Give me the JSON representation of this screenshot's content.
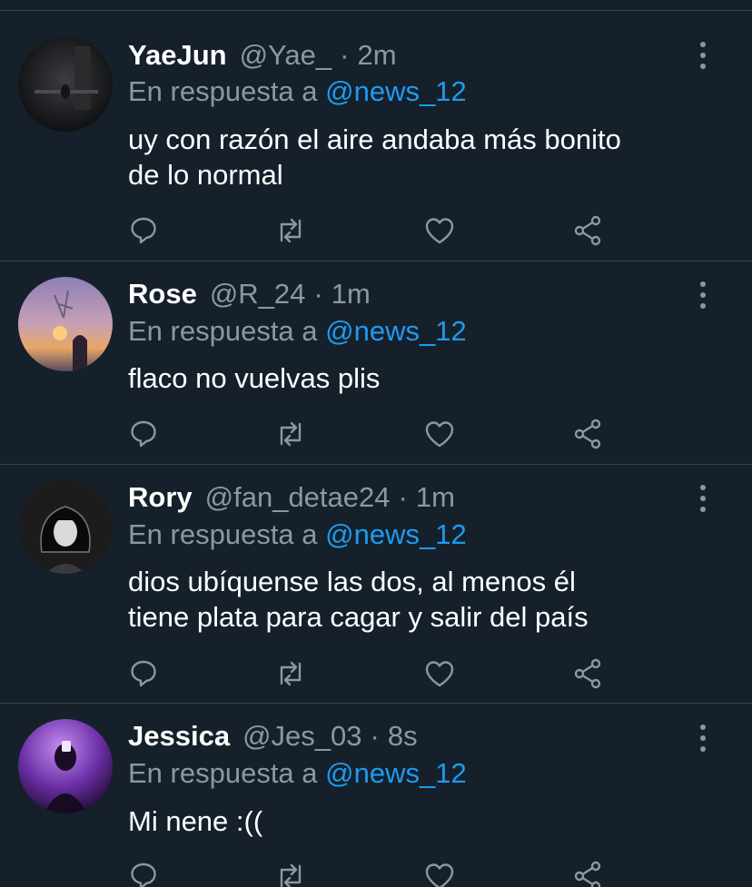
{
  "colors": {
    "background": "#15202b",
    "divider": "#38444d",
    "muted": "#8899a6",
    "mention": "#1d9bf0",
    "text": "#ffffff"
  },
  "icons": {
    "reply": "speech-bubble",
    "retweet": "retweet-arrows",
    "like": "heart",
    "share": "share-nodes",
    "more": "vertical-ellipsis"
  },
  "tweets": [
    {
      "name": "YaeJun",
      "handle": "@Yae_",
      "separator": "·",
      "time": "2m",
      "reply_prefix": "En respuesta a",
      "reply_to": "@news_12",
      "text_lines": [
        "uy con razón el aire andaba más bonito",
        "de lo normal"
      ]
    },
    {
      "name": "Rose",
      "handle": "@R_24",
      "separator": "·",
      "time": "1m",
      "reply_prefix": "En respuesta a",
      "reply_to": "@news_12",
      "text_lines": [
        "flaco no vuelvas plis"
      ]
    },
    {
      "name": "Rory",
      "handle": "@fan_detae24",
      "separator": "·",
      "time": "1m",
      "reply_prefix": "En respuesta a",
      "reply_to": "@news_12",
      "text_lines": [
        "dios ubíquense las dos, al menos él",
        "tiene plata para cagar y salir del país"
      ]
    },
    {
      "name": "Jessica",
      "handle": "@Jes_03",
      "separator": "·",
      "time": "8s",
      "reply_prefix": "En respuesta a",
      "reply_to": "@news_12",
      "text_lines": [
        "Mi nene :(("
      ]
    }
  ]
}
